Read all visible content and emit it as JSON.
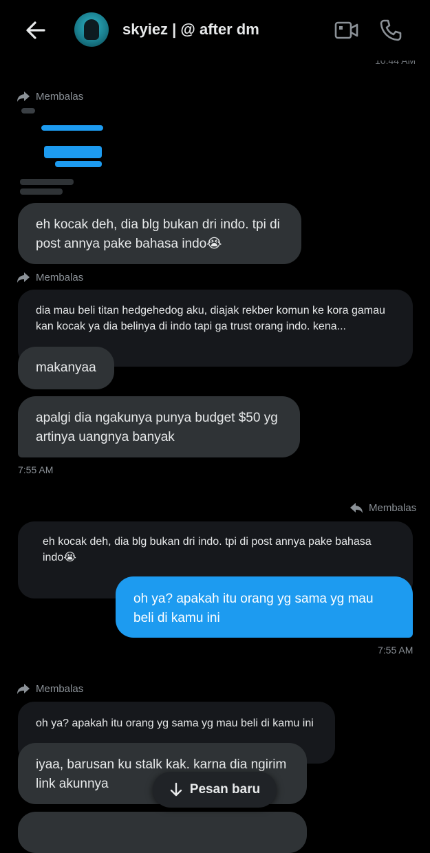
{
  "header": {
    "title": "skyiez | @ after dm",
    "back_icon": "arrow-left-icon",
    "video_icon": "video-camera-icon",
    "call_icon": "phone-icon"
  },
  "messages": {
    "clipped_timestamp": "10:44 AM",
    "reply_label": "Membalas",
    "bubble1": "eh kocak deh, dia blg bukan dri indo. tpi di post annya pake bahasa indo😭",
    "quoted1": "dia mau beli titan hedgehedog aku, diajak rekber komun ke kora gamau kan kocak ya dia belinya di indo tapi ga trust orang indo. kena...",
    "bubble2": "makanyaa",
    "bubble3": "apalgi dia ngakunya punya budget $50 yg artinya uangnya banyak",
    "timestamp1": "7:55 AM",
    "quoted2": "eh kocak deh, dia blg bukan dri indo. tpi di post annya pake bahasa indo😭",
    "sent1": "oh ya? apakah itu orang yg sama yg mau beli di kamu ini",
    "timestamp2": "7:55 AM",
    "quoted3": "oh ya? apakah itu orang yg sama yg mau beli di kamu ini",
    "bubble4": "iyaa, barusan ku stalk kak. karna dia ngirim link akunnya"
  },
  "new_message_button": {
    "label": "Pesan baru",
    "icon": "arrow-down-icon"
  },
  "colors": {
    "background": "#000000",
    "received_bubble": "#2f3336",
    "quoted_bubble": "#16181c",
    "sent_bubble": "#1d9bf0",
    "muted_text": "#8b9197"
  }
}
